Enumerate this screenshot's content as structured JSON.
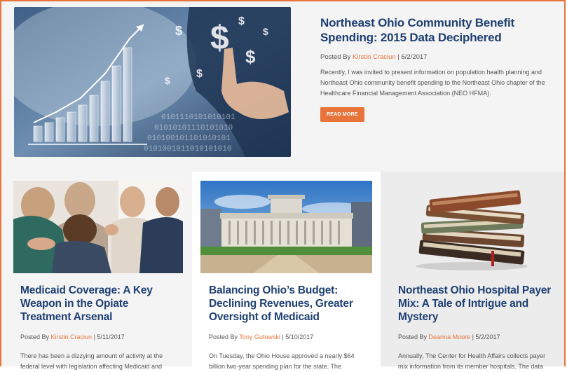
{
  "featured": {
    "title": "Northeast Ohio Community Benefit Spending: 2015 Data Deciphered",
    "posted_by": "Posted By",
    "author": "Kirstin Craciun",
    "date": " | 6/2/2017",
    "excerpt": "Recently, I was invited to present information on population health planning and Northeast Ohio community benefit spending to the Northeast Ohio chapter of the Healthcare Financial Management Association (NEO HFMA).",
    "button_label": "READ MORE",
    "image_icon": "finance-chart-image"
  },
  "cards": [
    {
      "title": "Medicaid Coverage: A Key Weapon in the Opiate Treatment Arsenal",
      "posted_by": "Posted By",
      "author": "Kirstin Craciun",
      "date": " | 5/11/2017",
      "excerpt": "There has been a dizzying amount of activity at the federal level with legislation affecting Medicaid and",
      "image_icon": "support-group-image"
    },
    {
      "title": "Balancing Ohio’s Budget: Declining Revenues, Greater Oversight of Medicaid",
      "posted_by": "Posted By",
      "author": "Tony Gutowski",
      "date": " | 5/10/2017",
      "excerpt": "On Tuesday, the Ohio House approved a nearly $64 billion two-year spending plan for the state. The",
      "image_icon": "ohio-statehouse-image"
    },
    {
      "title": "Northeast Ohio Hospital Payer Mix: A Tale of Intrigue and Mystery",
      "posted_by": "Posted By",
      "author": "Deanna Moore",
      "date": " | 5/2/2017",
      "excerpt": "Annually, The Center for Health Affairs collects payer mix information from its member hospitals. The data",
      "image_icon": "book-stack-image"
    }
  ],
  "colors": {
    "accent": "#e8743b",
    "title": "#1d3f73"
  }
}
